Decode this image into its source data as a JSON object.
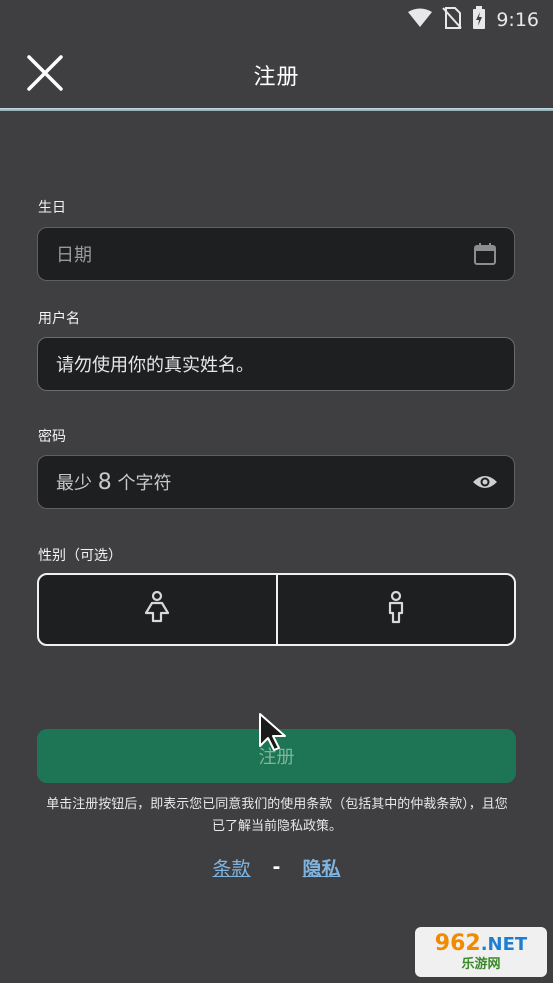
{
  "status_bar": {
    "time": "9:16",
    "icons": [
      "wifi-icon",
      "no-sim-icon",
      "battery-charging-icon"
    ]
  },
  "app_bar": {
    "title": "注册",
    "close_icon": "close-icon"
  },
  "form": {
    "birthday": {
      "label": "生日",
      "placeholder": "日期",
      "icon": "calendar-icon"
    },
    "username": {
      "label": "用户名",
      "value": "请勿使用你的真实姓名。"
    },
    "password": {
      "label": "密码",
      "placeholder_prefix": "最少",
      "placeholder_number": "8",
      "placeholder_suffix": "个字符",
      "icon": "eye-icon"
    },
    "gender": {
      "label": "性别（可选）",
      "options": [
        "female-icon",
        "male-icon"
      ]
    }
  },
  "submit_button": {
    "label": "注册",
    "color": "#1d7555"
  },
  "disclaimer": "单击注册按钮后，即表示您已同意我们的使用条款（包括其中的仲裁条款），且您已了解当前隐私政策。",
  "links": {
    "terms": "条款",
    "separator": "-",
    "privacy": "隐私"
  },
  "watermark": {
    "top_number": "962",
    "top_suffix": ".NET",
    "bottom": "乐游网"
  }
}
